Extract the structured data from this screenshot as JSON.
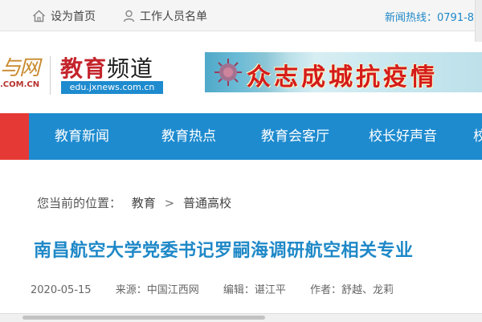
{
  "topbar": {
    "home_label": "设为首页",
    "staff_label": "工作人员名单",
    "hotline": "新闻热线：0791-8"
  },
  "header": {
    "site_logo": "与网",
    "site_logo_sub": ".COM.CN",
    "channel_bold": "教育",
    "channel_rest": "频道",
    "channel_url": "edu.jxnews.com.cn",
    "banner_text": "众志成城抗疫情"
  },
  "nav": {
    "items": [
      "教育新闻",
      "教育热点",
      "教育会客厅",
      "校长好声音",
      "校"
    ]
  },
  "breadcrumb": {
    "cropped": "置：",
    "prefix": "您当前的位置：",
    "level1": "教育",
    "separator": ">",
    "level2": "普通高校"
  },
  "article": {
    "title": "南昌航空大学党委书记罗嗣海调研航空相关专业",
    "date": "2020-05-15",
    "source": "来源：中国江西网",
    "editor": "编辑：谌江平",
    "author": "作者：舒越、龙莉"
  },
  "colors": {
    "brand_blue": "#1e8bcf",
    "accent_red": "#e53935",
    "title_blue": "#1e88c7"
  },
  "icons": [
    "home-icon",
    "user-icon",
    "virus-icon"
  ]
}
